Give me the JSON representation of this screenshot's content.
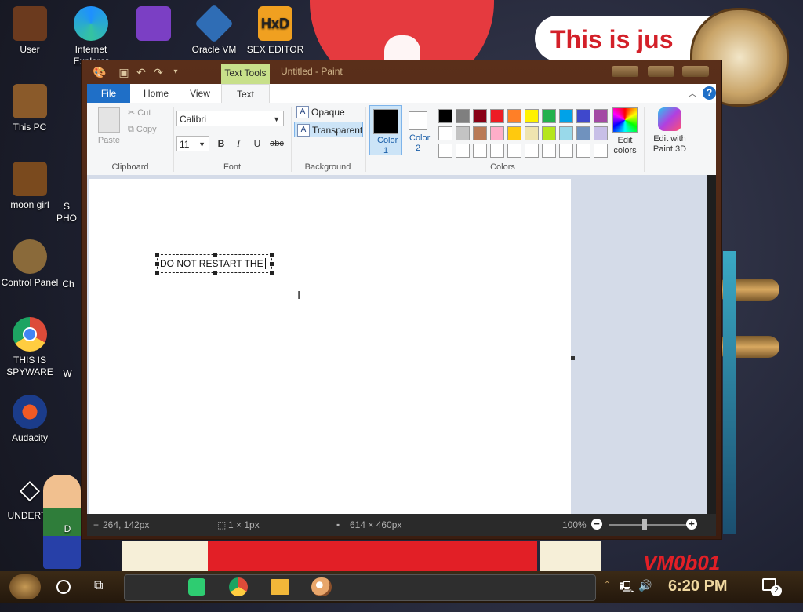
{
  "desktop": {
    "icons": [
      {
        "label": "User",
        "icon": "user-folder-icon",
        "color": "#6b3a1e"
      },
      {
        "label": "This PC",
        "icon": "computer-icon",
        "color": "#8a5a2a"
      },
      {
        "label": "moon girl",
        "icon": "folder-icon",
        "color": "#7a4a1e"
      },
      {
        "label": "Control Panel",
        "icon": "control-panel-icon",
        "color": "#8a6a3a"
      },
      {
        "label": "THIS IS SPYWARE",
        "icon": "chrome-icon",
        "color": "#dd4b39"
      },
      {
        "label": "Audacity",
        "icon": "audacity-icon",
        "color": "#f15a24"
      },
      {
        "label": "UNDERTA",
        "icon": "unity-icon",
        "color": "#222222"
      },
      {
        "label": "Internet Explorer",
        "icon": "edge-icon",
        "color": "#1e90ff"
      },
      {
        "label": "",
        "icon": "visual-studio-icon",
        "color": "#7b3fc4"
      },
      {
        "label": "Oracle VM",
        "icon": "virtualbox-icon",
        "color": "#2f6db5"
      },
      {
        "label": "SEX EDITOR",
        "icon": "hxd-icon",
        "color": "#f0a020"
      }
    ],
    "partial_labels": [
      "S",
      "PHO",
      "Ch",
      "W",
      "D"
    ],
    "banner_text": "This is jus",
    "wall_text": "VM0b01"
  },
  "paint": {
    "window_title": "Untitled - Paint",
    "context_tab": "Text Tools",
    "tabs": [
      "File",
      "Home",
      "View",
      "Text"
    ],
    "ribbon": {
      "clipboard": {
        "paste": "Paste",
        "cut": "Cut",
        "copy": "Copy",
        "group": "Clipboard"
      },
      "font": {
        "family": "Calibri",
        "size": "11",
        "bold": "B",
        "italic": "I",
        "underline": "U",
        "strike": "abc",
        "group": "Font"
      },
      "background": {
        "opaque": "Opaque",
        "transparent": "Transparent",
        "group": "Background"
      },
      "colors": {
        "color1_label": "Color 1",
        "color2_label": "Color 2",
        "color1": "#000000",
        "color2": "#ffffff",
        "edit_colors": "Edit colors",
        "group": "Colors",
        "palette_row1": [
          "#000000",
          "#7f7f7f",
          "#880015",
          "#ed1c24",
          "#ff7f27",
          "#fff200",
          "#22b14c",
          "#00a2e8",
          "#3f48cc",
          "#a349a4"
        ],
        "palette_row2": [
          "#ffffff",
          "#c3c3c3",
          "#b97a57",
          "#ffaec9",
          "#ffc90e",
          "#efe4b0",
          "#b5e61d",
          "#99d9ea",
          "#7092be",
          "#c8bfe7"
        ]
      },
      "paint3d": "Edit with Paint 3D"
    },
    "canvas_text": "DO NOT RESTART THE",
    "status": {
      "cursor": "264, 142px",
      "selection": "1 × 1px",
      "size": "614 × 460px",
      "zoom": "100%"
    }
  },
  "taskbar": {
    "time": "6:20 PM",
    "notification_count": "2"
  }
}
